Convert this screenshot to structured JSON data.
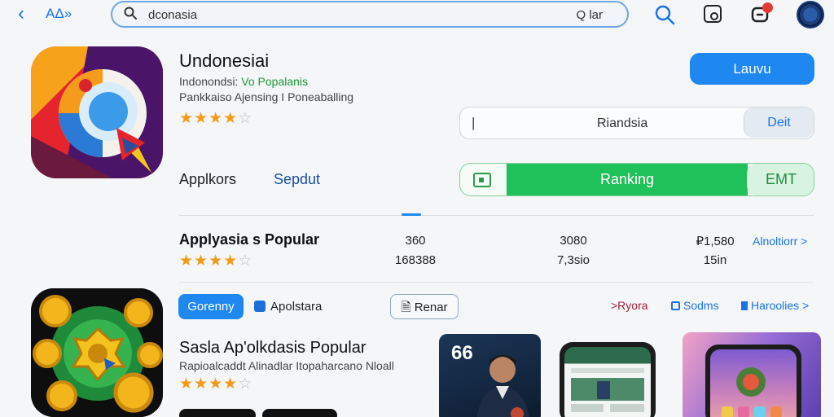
{
  "header": {
    "back_label": "AΔ»",
    "search_value": "dconasia",
    "search_right": "Q lar"
  },
  "app1": {
    "name": "Undonesiai",
    "subtitle_prefix": "Indonondsi: ",
    "subtitle_highlight": "Vo Popalanis",
    "subtitle2": "Pankkaiso Ajensing I Poneaballing",
    "rating_stars": 4,
    "primary_button": "Lauvu",
    "field_text": "Riandsia",
    "field_button": "Deit",
    "ranking_label": "Ranking",
    "ranking_side": "EMT",
    "tabs": [
      "Applkors",
      "Sepdut"
    ]
  },
  "popular": {
    "title": "Applyasia s Popular",
    "rating_stars": 4,
    "stats": [
      {
        "top": "360",
        "bottom": "168388"
      },
      {
        "top": "3080",
        "bottom": "7,3sio"
      },
      {
        "top": "₽1,580",
        "bottom": "15in"
      }
    ],
    "more_link": "Alnoltiorr >"
  },
  "app2": {
    "chip_primary": "Gorenny",
    "chip_category": "Apolstara",
    "chip_outline": "Renar",
    "tags": [
      ">Ryora",
      "Sodms",
      "Haroolies >"
    ],
    "title": "Sasla Ap'olkdasis Popular",
    "subtitle": "Rapioalcaddt Alinadlar Itopaharcano Nloall",
    "rating_stars": 4,
    "screenshot_number": "66"
  },
  "colors": {
    "accent_blue": "#1e88f0",
    "accent_green": "#20c05a",
    "star": "#f29b16"
  }
}
